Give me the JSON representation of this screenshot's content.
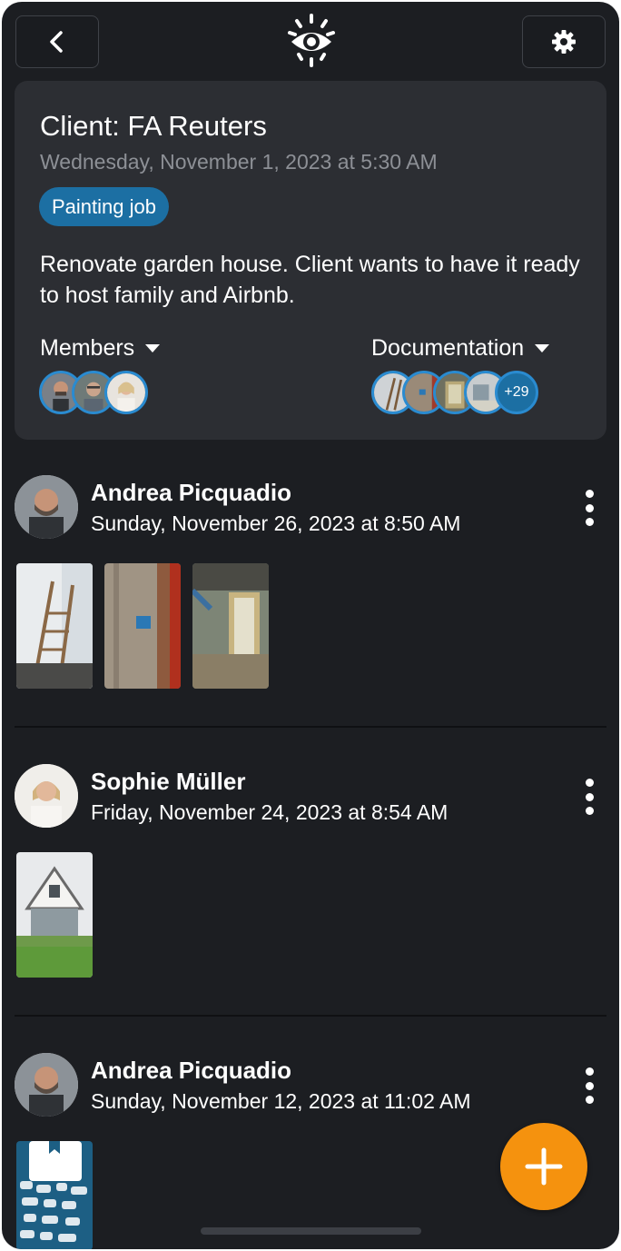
{
  "header": {
    "back_icon": "chevron-left-icon",
    "logo_icon": "eye-logo-icon",
    "settings_icon": "gear-icon"
  },
  "job": {
    "title": "Client: FA Reuters",
    "date": "Wednesday, November 1, 2023 at 5:30 AM",
    "tag": "Painting job",
    "description": "Renovate garden house. Client wants to have it ready to host family and Airbnb.",
    "members_label": "Members",
    "documentation_label": "Documentation",
    "documentation_more": "+29"
  },
  "posts": [
    {
      "author": "Andrea Picquadio",
      "date": "Sunday, November 26, 2023 at 8:50 AM",
      "photos": 3
    },
    {
      "author": "Sophie Müller",
      "date": "Friday, November 24, 2023 at 8:54 AM",
      "photos": 1
    },
    {
      "author": "Andrea Picquadio",
      "date": "Sunday, November 12, 2023 at 11:02 AM",
      "photos": 1
    }
  ],
  "fab": {
    "icon": "plus-icon"
  },
  "colors": {
    "background": "#1c1e22",
    "card": "#2c2e33",
    "tag": "#1c6fa3",
    "avatar_ring": "#2a8bd0",
    "fab": "#f5920e"
  }
}
